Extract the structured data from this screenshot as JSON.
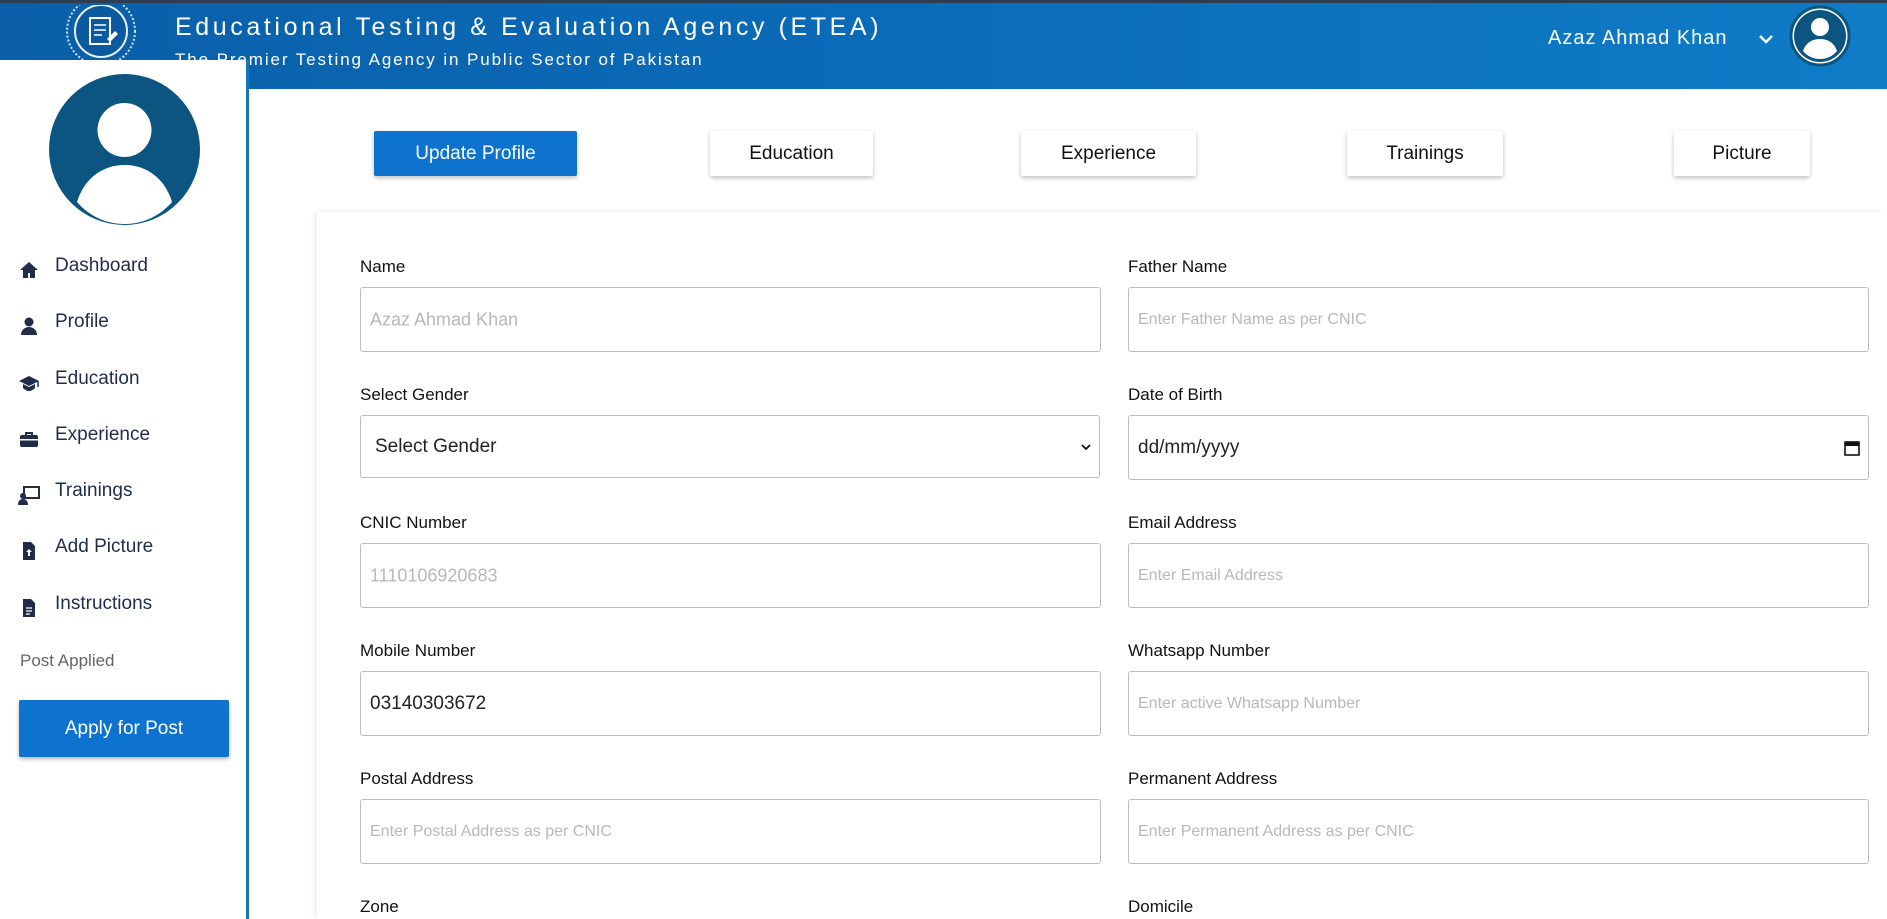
{
  "header": {
    "title": "Educational Testing & Evaluation Agency (ETEA)",
    "subtitle": "The Premier Testing Agency in Public Sector of Pakistan",
    "user_name": "Azaz Ahmad Khan"
  },
  "sidebar": {
    "items": [
      {
        "label": "Dashboard",
        "icon": "home-icon"
      },
      {
        "label": "Profile",
        "icon": "user-icon"
      },
      {
        "label": "Education",
        "icon": "graduation-cap-icon"
      },
      {
        "label": "Experience",
        "icon": "briefcase-icon"
      },
      {
        "label": "Trainings",
        "icon": "chalkboard-teacher-icon"
      },
      {
        "label": "Add Picture",
        "icon": "file-upload-icon"
      },
      {
        "label": "Instructions",
        "icon": "file-text-icon"
      }
    ],
    "post_applied": "Post Applied",
    "apply_button": "Apply for Post"
  },
  "tabs": [
    {
      "label": "Update Profile",
      "active": true
    },
    {
      "label": "Education",
      "active": false
    },
    {
      "label": "Experience",
      "active": false
    },
    {
      "label": "Trainings",
      "active": false
    },
    {
      "label": "Picture",
      "active": false
    }
  ],
  "form": {
    "name": {
      "label": "Name",
      "placeholder": "Azaz Ahmad Khan"
    },
    "father_name": {
      "label": "Father Name",
      "placeholder": "Enter Father Name as per CNIC"
    },
    "gender": {
      "label": "Select Gender",
      "value": "Select Gender"
    },
    "dob": {
      "label": "Date of Birth",
      "value": "dd/mm/yyyy"
    },
    "cnic": {
      "label": "CNIC Number",
      "placeholder": "1110106920683"
    },
    "email": {
      "label": "Email Address",
      "placeholder": "Enter Email Address"
    },
    "mobile": {
      "label": "Mobile Number",
      "value": "03140303672"
    },
    "whatsapp": {
      "label": "Whatsapp Number",
      "placeholder": "Enter active Whatsapp Number"
    },
    "postal_address": {
      "label": "Postal Address",
      "placeholder": "Enter Postal Address as per CNIC"
    },
    "permanent_address": {
      "label": "Permanent Address",
      "placeholder": "Enter Permanent Address as per CNIC"
    },
    "zone": {
      "label": "Zone"
    },
    "domicile": {
      "label": "Domicile"
    }
  },
  "colors": {
    "header_blue": "#0a6bb8",
    "accent_blue": "#0d73cf",
    "sidebar_text": "#1f2d4a",
    "avatar_blue": "#0b5580"
  }
}
